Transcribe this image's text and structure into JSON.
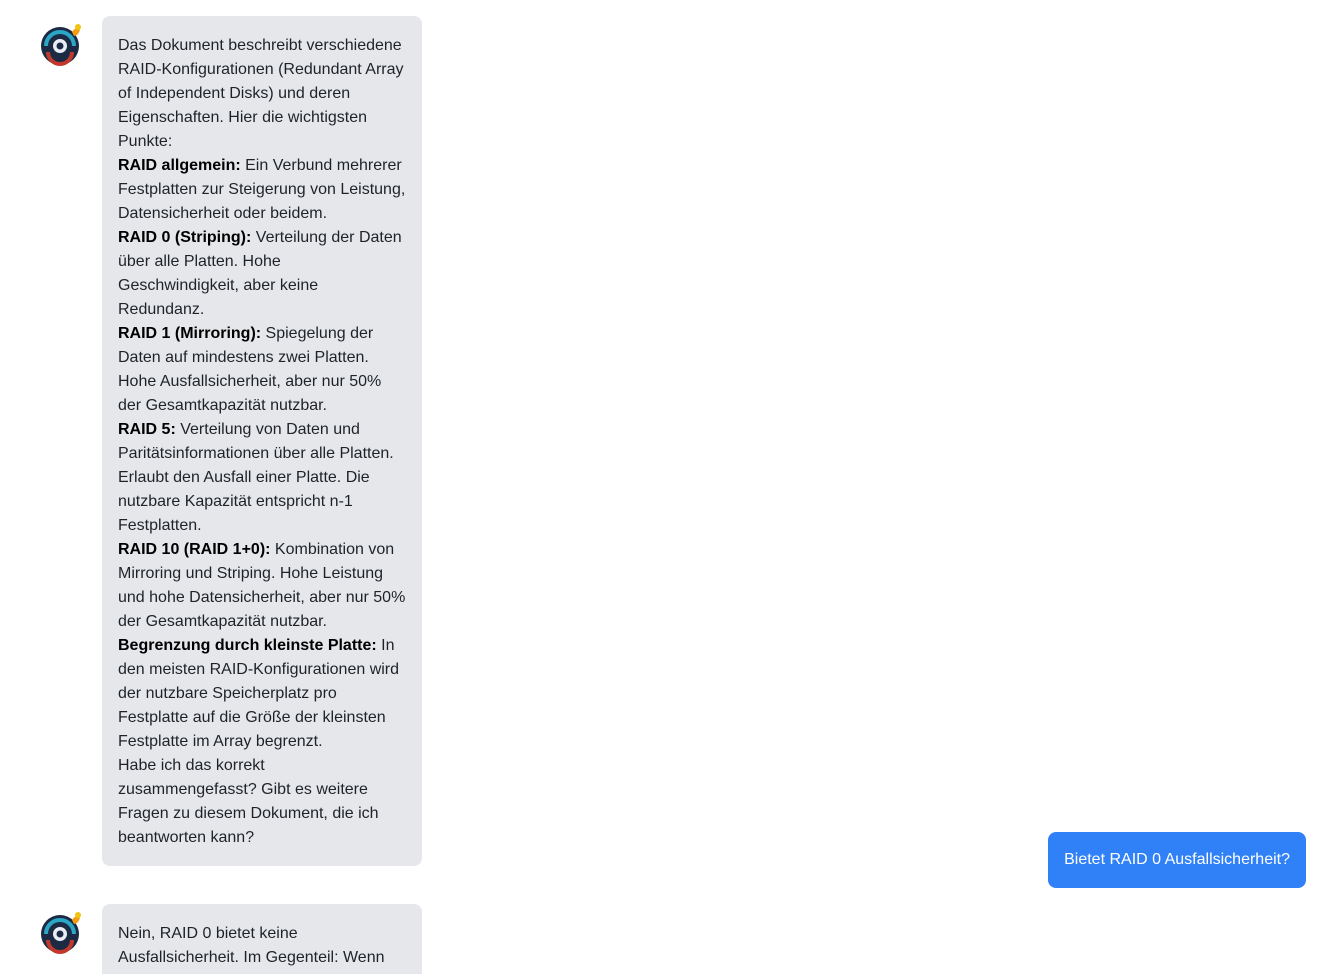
{
  "messages": [
    {
      "role": "assistant",
      "intro": "Das Dokument beschreibt verschiedene RAID-Konfigurationen (Redundant Array of Independent Disks) und deren Eigenschaften. Hier die wichtigsten Punkte:",
      "points": [
        {
          "label": "RAID allgemein:",
          "text": " Ein Verbund mehrerer Festplatten zur Steigerung von Leistung, Datensicherheit oder beidem."
        },
        {
          "label": "RAID 0 (Striping):",
          "text": " Verteilung der Daten über alle Platten. Hohe Geschwindigkeit, aber keine Redundanz."
        },
        {
          "label": "RAID 1 (Mirroring):",
          "text": " Spiegelung der Daten auf mindestens zwei Platten. Hohe Ausfallsicherheit, aber nur 50% der Gesamtkapazität nutzbar."
        },
        {
          "label": "RAID 5:",
          "text": " Verteilung von Daten und Paritätsinformationen über alle Platten. Erlaubt den Ausfall einer Platte. Die nutzbare Kapazität entspricht n-1 Festplatten."
        },
        {
          "label": "RAID 10 (RAID 1+0):",
          "text": " Kombination von Mirroring und Striping. Hohe Leistung und hohe Datensicherheit, aber nur 50% der Gesamtkapazität nutzbar."
        },
        {
          "label": "Begrenzung durch kleinste Platte:",
          "text": " In den meisten RAID-Konfigurationen wird der nutzbare Speicherplatz pro Festplatte auf die Größe der kleinsten Festplatte im Array begrenzt."
        }
      ],
      "outro": "Habe ich das korrekt zusammengefasst? Gibt es weitere Fragen zu diesem Dokument, die ich beantworten kann?"
    },
    {
      "role": "user",
      "text": "Bietet RAID 0 Ausfallsicherheit?"
    },
    {
      "role": "assistant",
      "text": "Nein, RAID 0 bietet keine Ausfallsicherheit. Im Gegenteil: Wenn"
    }
  ],
  "colors": {
    "assistant_bubble": "#e5e7eb",
    "user_bubble": "#3081f7"
  },
  "icons": {
    "assistant_avatar": "bot-avatar-icon"
  }
}
